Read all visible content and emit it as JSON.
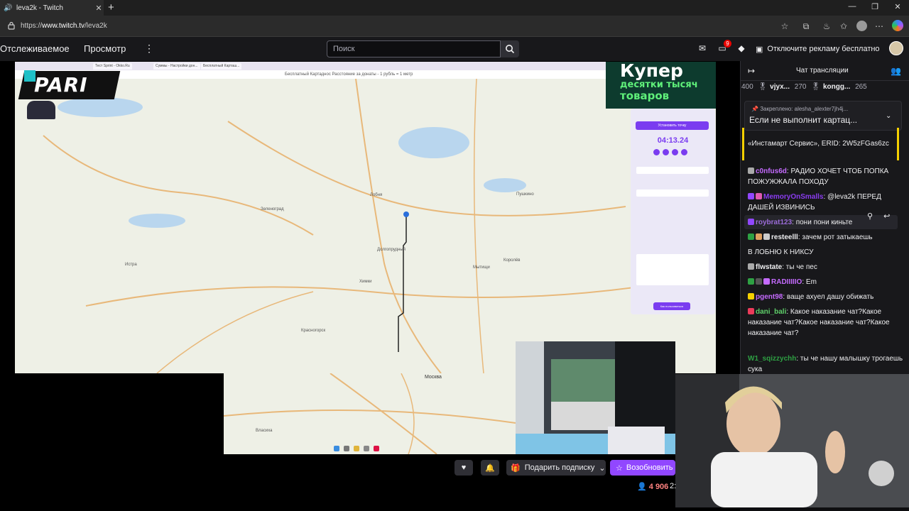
{
  "browser": {
    "tab_title": "leva2k - Twitch",
    "url_prefix": "https://",
    "url_host": "www.twitch.tv",
    "url_path": "/leva2k"
  },
  "twitch_nav": {
    "following": "Отслеживаемое",
    "browse": "Просмотр",
    "search_placeholder": "Поиск",
    "notif_count": "9",
    "adfree": "Отключите рекламу бесплатно"
  },
  "stream": {
    "in_tabs": [
      "Тест Sprint - Okko.Ru",
      "Суммы - Настройки дон...",
      "Бесплатный Карташ..."
    ],
    "in_address": "Бесплатный Картаднос Расстояние за донаты - 1 рубль = 1 метр",
    "map_labels": [
      "Зеленоград",
      "Долгопрудный",
      "Химки",
      "Мытищи",
      "Королёв",
      "Пушкино",
      "Красногорск",
      "Москва",
      "Истра",
      "Лобня",
      "Власиха"
    ],
    "pari_logo": "PARI",
    "kuper_line1": "Купер",
    "kuper_line2": "десятки тысяч",
    "kuper_line3": "товаров",
    "panel_button": "Установить точку",
    "timer": "04:13.24",
    "panel_button2": "Как пользоваться",
    "actions": {
      "gift": "Подарить подписку",
      "subscribe": "Возобновить",
      "viewers": "4 906",
      "viewers_extra": "2:"
    }
  },
  "chat": {
    "title": "Чат трансляции",
    "gifters": [
      {
        "count": "400",
        "name": ""
      },
      {
        "count": "",
        "name": "vjyx..."
      },
      {
        "count": "270",
        "name": ""
      },
      {
        "count": "",
        "name": "kongg..."
      },
      {
        "count": "265",
        "name": ""
      }
    ],
    "pinned_meta": "Закреплено: alesha_alexter7jh4j...",
    "pinned_text": "Если не выполнит картац...",
    "messages": [
      {
        "user": "",
        "text": "«Инстамарт Сервис», ERID: 2W5zFGas6zc",
        "color": "#efeff1"
      },
      {
        "user": "c0nfus6d",
        "text": "РАДИО ХОЧЕТ ЧТОБ ПОПКА ПОЖУЖЖАЛА ПОХОДУ",
        "color": "#c56bff"
      },
      {
        "user": "MemoryOnSmalls",
        "text": "@leva2k ПЕРЕД ДАШЕЙ ИЗВИНИСЬ",
        "color": "#8a3cf0"
      },
      {
        "user": "roybrat123",
        "text": "пони пони киньте",
        "color": "#9b6bd8"
      },
      {
        "user": "resteelll",
        "text": "зачем рот затыкаешь",
        "color": "#efeff1"
      },
      {
        "user": "",
        "text": "В ЛОБНЮ К НИКСУ",
        "color": "#4b4bff"
      },
      {
        "user": "flwstate",
        "text": "ты че пес",
        "color": "#efeff1"
      },
      {
        "user": "RADIIIIIO",
        "text": "Em",
        "color": "#c56bff"
      },
      {
        "user": "pgent98",
        "text": "ваще ахуел дашу обижать",
        "color": "#c56bff"
      },
      {
        "user": "dani_bali",
        "text": "Какое наказание чат?Какое наказание чат?Какое наказание чат?Какое наказание чат?",
        "color": "#5fd06a"
      },
      {
        "user": "W1_sqizzychh",
        "text": "ты че нашу малышку трогаешь сука",
        "color": "#2ea043"
      }
    ]
  },
  "colors": {
    "twitch_purple": "#9147ff",
    "bg_dark": "#0e0e10",
    "chat_bg": "#18181b"
  }
}
